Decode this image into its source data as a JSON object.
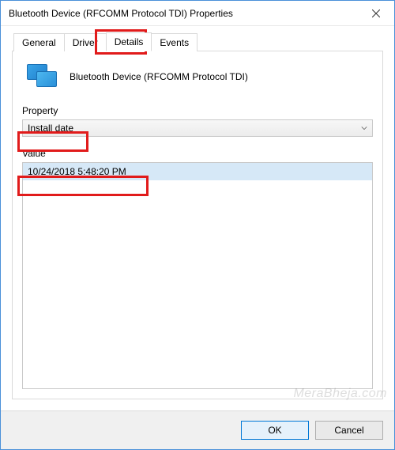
{
  "window": {
    "title": "Bluetooth Device (RFCOMM Protocol TDI) Properties"
  },
  "tabs": {
    "general": "General",
    "driver": "Driver",
    "details": "Details",
    "events": "Events",
    "active": "details"
  },
  "details": {
    "device_name": "Bluetooth Device (RFCOMM Protocol TDI)",
    "property_label": "Property",
    "property_value": "Install date",
    "value_label": "Value",
    "value_text": "10/24/2018 5:48:20 PM"
  },
  "buttons": {
    "ok": "OK",
    "cancel": "Cancel"
  },
  "watermark": "MeraBheja.com"
}
